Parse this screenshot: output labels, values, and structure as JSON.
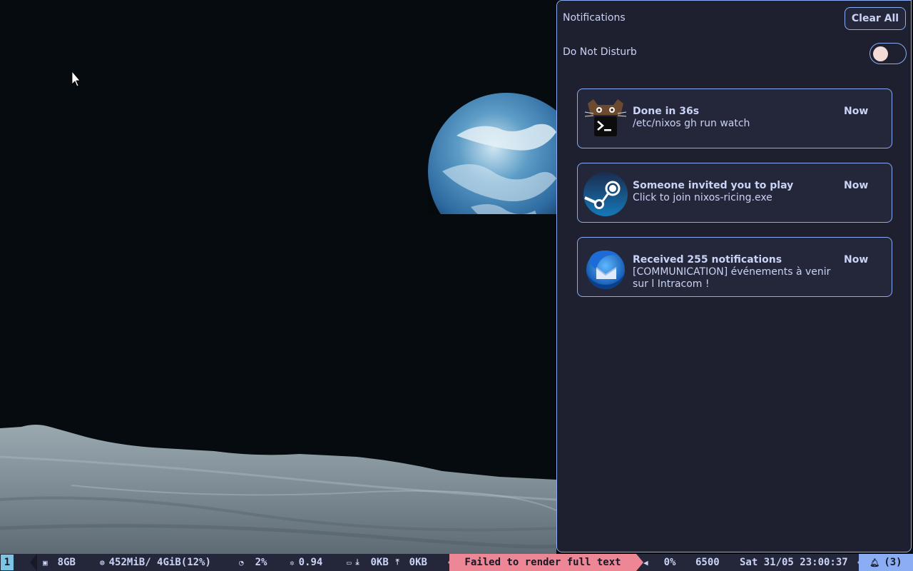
{
  "notification_center": {
    "title": "Notifications",
    "clear_all_label": "Clear All",
    "dnd_label": "Do Not Disturb",
    "dnd_enabled": false,
    "notifications": [
      {
        "summary": "Done in 36s",
        "body": "/etc/nixos gh run watch",
        "time": "Now",
        "icon": "terminal-cat-icon"
      },
      {
        "summary": "Someone invited you to play",
        "body": "Click to join nixos-ricing.exe",
        "time": "Now",
        "icon": "steam-icon"
      },
      {
        "summary": "Received 255 notifications",
        "body": "[COMMUNICATION] événements à venir sur l Intracom !",
        "time": "Now",
        "icon": "thunderbird-icon"
      }
    ]
  },
  "bar": {
    "workspace": "1",
    "disk": "8GB",
    "memory": "452MiB/ 4GiB(12%)",
    "cpu": "2%",
    "load": "0.94",
    "net_down": "0KB",
    "net_up": "0KB",
    "error": "Failed to render full text",
    "volume": "0%",
    "temperature": "6500",
    "datetime": "Sat 31/05 23:00:37",
    "notif_count": "(3)"
  },
  "colors": {
    "accent": "#8aadf4",
    "panel_bg": "#1e2030",
    "card_bg": "#24273a",
    "text": "#cad3f5",
    "error": "#ed8796",
    "workspace": "#7dc4e4",
    "toggle_knob": "#f4dbd6"
  }
}
